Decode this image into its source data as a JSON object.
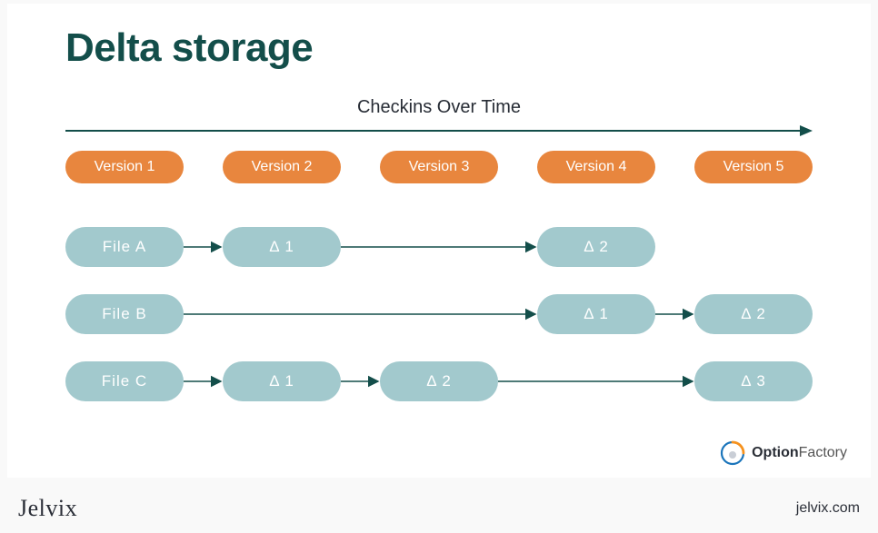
{
  "title": "Delta storage",
  "timeline_label": "Checkins Over Time",
  "versions": {
    "v1": "Version 1",
    "v2": "Version 2",
    "v3": "Version 3",
    "v4": "Version 4",
    "v5": "Version 5"
  },
  "files": {
    "a": {
      "name": "File A",
      "d1": "Δ 1",
      "d2": "Δ 2"
    },
    "b": {
      "name": "File B",
      "d1": "Δ 1",
      "d2": "Δ 2"
    },
    "c": {
      "name": "File C",
      "d1": "Δ 1",
      "d2": "Δ 2",
      "d3": "Δ 3"
    }
  },
  "logos": {
    "option_bold": "Option",
    "option_light": "Factory",
    "jelvix": "Jelvix",
    "url": "jelvix.com"
  },
  "colors": {
    "title": "#134e4a",
    "version_pill": "#e8863e",
    "node": "#a2c9cd",
    "arrow": "#134e4a",
    "logo_blue": "#1b75bb",
    "logo_orange": "#f6921e"
  }
}
